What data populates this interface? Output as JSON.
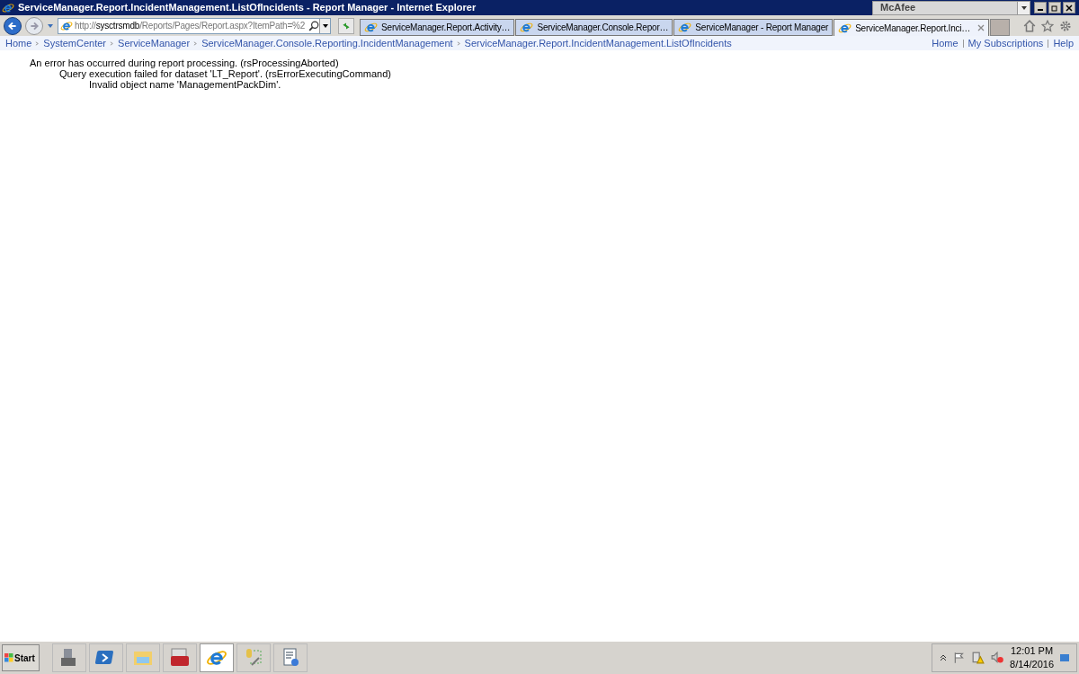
{
  "window": {
    "title": "ServiceManager.Report.IncidentManagement.ListOfIncidents - Report Manager - Internet Explorer",
    "toolbar_search": "McAfee"
  },
  "address": {
    "scheme": "http://",
    "host": "sysctrsmdb",
    "path": "/Reports/Pages/Report.aspx?ItemPath=%2"
  },
  "tabs": [
    {
      "label": "ServiceManager.Report.Activity…",
      "selected": false
    },
    {
      "label": "ServiceManager.Console.Repor…",
      "selected": false
    },
    {
      "label": "ServiceManager - Report Manager",
      "selected": false
    },
    {
      "label": "ServiceManager.Report.Inci…",
      "selected": true
    }
  ],
  "breadcrumb": [
    "Home",
    "SystemCenter",
    "ServiceManager",
    "ServiceManager.Console.Reporting.IncidentManagement",
    "ServiceManager.Report.IncidentManagement.ListOfIncidents"
  ],
  "top_links": [
    "Home",
    "My Subscriptions",
    "Help"
  ],
  "errors": [
    {
      "text": "An error has occurred during report processing. (rsProcessingAborted)",
      "children": [
        {
          "text": "Query execution failed for dataset 'LT_Report'. (rsErrorExecutingCommand)",
          "children": [
            {
              "text": "Invalid object name 'ManagementPackDim'."
            }
          ]
        }
      ]
    }
  ],
  "taskbar": {
    "start": "Start",
    "apps": [
      {
        "kind": "server",
        "selected": false
      },
      {
        "kind": "shell",
        "selected": false
      },
      {
        "kind": "folder",
        "selected": false
      },
      {
        "kind": "toolbox",
        "selected": false
      },
      {
        "kind": "browser",
        "selected": true
      },
      {
        "kind": "database",
        "selected": false
      },
      {
        "kind": "report",
        "selected": false
      }
    ],
    "time": "12:01 PM",
    "date": "8/14/2016"
  }
}
